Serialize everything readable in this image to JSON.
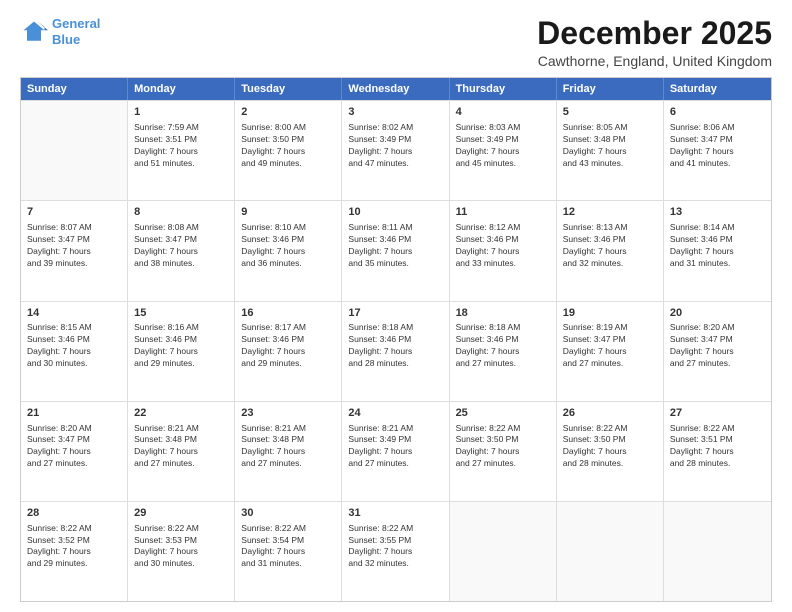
{
  "header": {
    "logo_line1": "General",
    "logo_line2": "Blue",
    "main_title": "December 2025",
    "subtitle": "Cawthorne, England, United Kingdom"
  },
  "calendar": {
    "days_of_week": [
      "Sunday",
      "Monday",
      "Tuesday",
      "Wednesday",
      "Thursday",
      "Friday",
      "Saturday"
    ],
    "weeks": [
      [
        {
          "day": "",
          "info": ""
        },
        {
          "day": "1",
          "info": "Sunrise: 7:59 AM\nSunset: 3:51 PM\nDaylight: 7 hours\nand 51 minutes."
        },
        {
          "day": "2",
          "info": "Sunrise: 8:00 AM\nSunset: 3:50 PM\nDaylight: 7 hours\nand 49 minutes."
        },
        {
          "day": "3",
          "info": "Sunrise: 8:02 AM\nSunset: 3:49 PM\nDaylight: 7 hours\nand 47 minutes."
        },
        {
          "day": "4",
          "info": "Sunrise: 8:03 AM\nSunset: 3:49 PM\nDaylight: 7 hours\nand 45 minutes."
        },
        {
          "day": "5",
          "info": "Sunrise: 8:05 AM\nSunset: 3:48 PM\nDaylight: 7 hours\nand 43 minutes."
        },
        {
          "day": "6",
          "info": "Sunrise: 8:06 AM\nSunset: 3:47 PM\nDaylight: 7 hours\nand 41 minutes."
        }
      ],
      [
        {
          "day": "7",
          "info": "Sunrise: 8:07 AM\nSunset: 3:47 PM\nDaylight: 7 hours\nand 39 minutes."
        },
        {
          "day": "8",
          "info": "Sunrise: 8:08 AM\nSunset: 3:47 PM\nDaylight: 7 hours\nand 38 minutes."
        },
        {
          "day": "9",
          "info": "Sunrise: 8:10 AM\nSunset: 3:46 PM\nDaylight: 7 hours\nand 36 minutes."
        },
        {
          "day": "10",
          "info": "Sunrise: 8:11 AM\nSunset: 3:46 PM\nDaylight: 7 hours\nand 35 minutes."
        },
        {
          "day": "11",
          "info": "Sunrise: 8:12 AM\nSunset: 3:46 PM\nDaylight: 7 hours\nand 33 minutes."
        },
        {
          "day": "12",
          "info": "Sunrise: 8:13 AM\nSunset: 3:46 PM\nDaylight: 7 hours\nand 32 minutes."
        },
        {
          "day": "13",
          "info": "Sunrise: 8:14 AM\nSunset: 3:46 PM\nDaylight: 7 hours\nand 31 minutes."
        }
      ],
      [
        {
          "day": "14",
          "info": "Sunrise: 8:15 AM\nSunset: 3:46 PM\nDaylight: 7 hours\nand 30 minutes."
        },
        {
          "day": "15",
          "info": "Sunrise: 8:16 AM\nSunset: 3:46 PM\nDaylight: 7 hours\nand 29 minutes."
        },
        {
          "day": "16",
          "info": "Sunrise: 8:17 AM\nSunset: 3:46 PM\nDaylight: 7 hours\nand 29 minutes."
        },
        {
          "day": "17",
          "info": "Sunrise: 8:18 AM\nSunset: 3:46 PM\nDaylight: 7 hours\nand 28 minutes."
        },
        {
          "day": "18",
          "info": "Sunrise: 8:18 AM\nSunset: 3:46 PM\nDaylight: 7 hours\nand 27 minutes."
        },
        {
          "day": "19",
          "info": "Sunrise: 8:19 AM\nSunset: 3:47 PM\nDaylight: 7 hours\nand 27 minutes."
        },
        {
          "day": "20",
          "info": "Sunrise: 8:20 AM\nSunset: 3:47 PM\nDaylight: 7 hours\nand 27 minutes."
        }
      ],
      [
        {
          "day": "21",
          "info": "Sunrise: 8:20 AM\nSunset: 3:47 PM\nDaylight: 7 hours\nand 27 minutes."
        },
        {
          "day": "22",
          "info": "Sunrise: 8:21 AM\nSunset: 3:48 PM\nDaylight: 7 hours\nand 27 minutes."
        },
        {
          "day": "23",
          "info": "Sunrise: 8:21 AM\nSunset: 3:48 PM\nDaylight: 7 hours\nand 27 minutes."
        },
        {
          "day": "24",
          "info": "Sunrise: 8:21 AM\nSunset: 3:49 PM\nDaylight: 7 hours\nand 27 minutes."
        },
        {
          "day": "25",
          "info": "Sunrise: 8:22 AM\nSunset: 3:50 PM\nDaylight: 7 hours\nand 27 minutes."
        },
        {
          "day": "26",
          "info": "Sunrise: 8:22 AM\nSunset: 3:50 PM\nDaylight: 7 hours\nand 28 minutes."
        },
        {
          "day": "27",
          "info": "Sunrise: 8:22 AM\nSunset: 3:51 PM\nDaylight: 7 hours\nand 28 minutes."
        }
      ],
      [
        {
          "day": "28",
          "info": "Sunrise: 8:22 AM\nSunset: 3:52 PM\nDaylight: 7 hours\nand 29 minutes."
        },
        {
          "day": "29",
          "info": "Sunrise: 8:22 AM\nSunset: 3:53 PM\nDaylight: 7 hours\nand 30 minutes."
        },
        {
          "day": "30",
          "info": "Sunrise: 8:22 AM\nSunset: 3:54 PM\nDaylight: 7 hours\nand 31 minutes."
        },
        {
          "day": "31",
          "info": "Sunrise: 8:22 AM\nSunset: 3:55 PM\nDaylight: 7 hours\nand 32 minutes."
        },
        {
          "day": "",
          "info": ""
        },
        {
          "day": "",
          "info": ""
        },
        {
          "day": "",
          "info": ""
        }
      ]
    ]
  }
}
